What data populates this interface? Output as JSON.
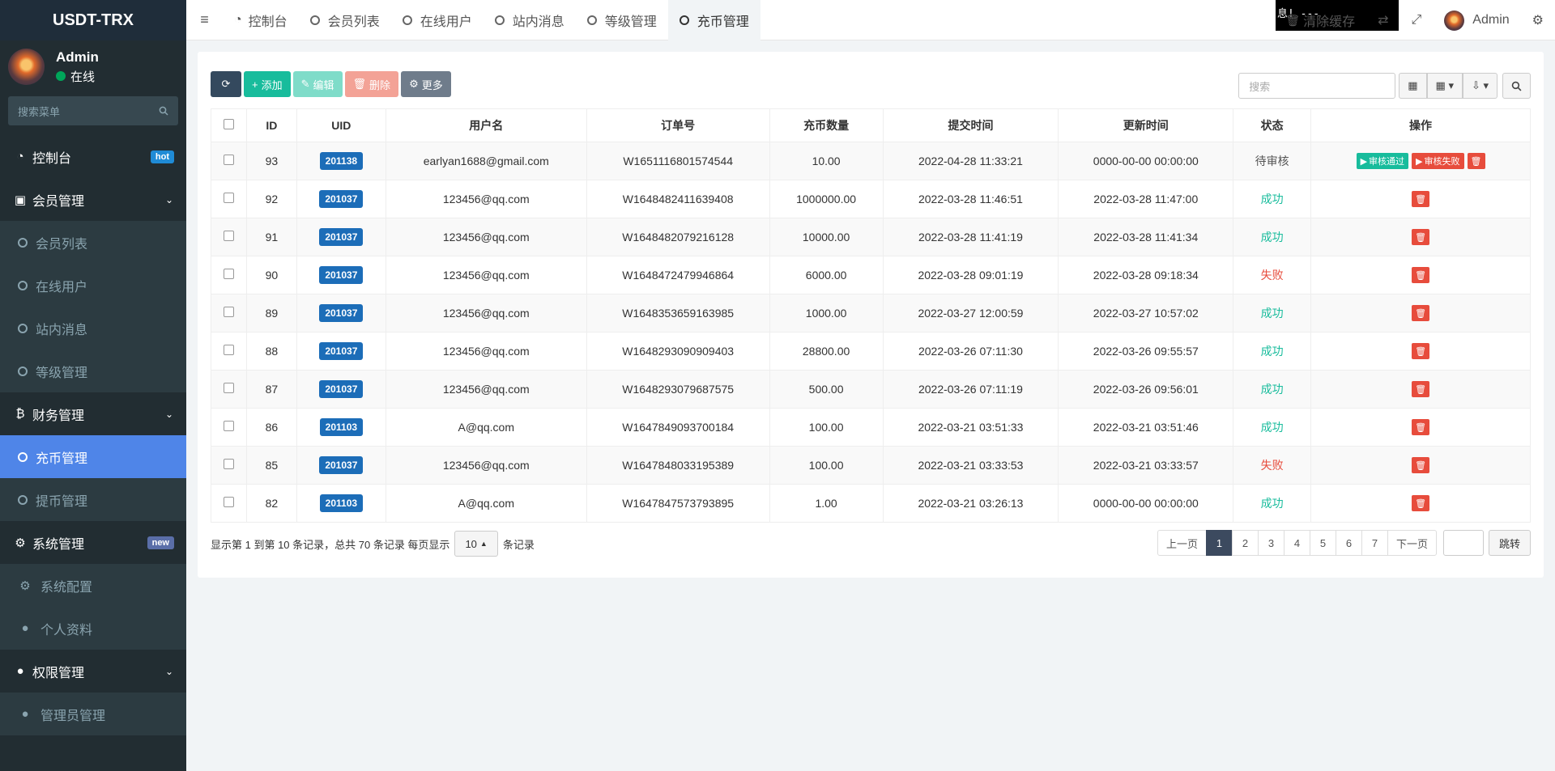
{
  "brand": "USDT-TRX",
  "user": {
    "name": "Admin",
    "status": "在线"
  },
  "sidebar": {
    "search_placeholder": "搜索菜单",
    "items": [
      {
        "label": "控制台",
        "badge": "hot"
      },
      {
        "label": "会员管理"
      },
      {
        "label": "会员列表"
      },
      {
        "label": "在线用户"
      },
      {
        "label": "站内消息"
      },
      {
        "label": "等级管理"
      },
      {
        "label": "财务管理"
      },
      {
        "label": "充币管理"
      },
      {
        "label": "提币管理"
      },
      {
        "label": "系统管理",
        "badge": "new"
      },
      {
        "label": "系统配置"
      },
      {
        "label": "个人资料"
      },
      {
        "label": "权限管理"
      },
      {
        "label": "管理员管理"
      }
    ]
  },
  "topbar": {
    "tabs": [
      "控制台",
      "会员列表",
      "在线用户",
      "站内消息",
      "等级管理",
      "充币管理"
    ],
    "console_text": "息! ---",
    "clear_cache": "清除缓存",
    "admin": "Admin"
  },
  "toolbar": {
    "add": "添加",
    "edit": "编辑",
    "delete": "删除",
    "more": "更多",
    "search_placeholder": "搜索"
  },
  "table": {
    "headers": [
      "ID",
      "UID",
      "用户名",
      "订单号",
      "充币数量",
      "提交时间",
      "更新时间",
      "状态",
      "操作"
    ],
    "rows": [
      {
        "id": "93",
        "uid": "201138",
        "username": "earlyan1688@gmail.com",
        "order": "W1651116801574544",
        "amount": "10.00",
        "submit": "2022-04-28 11:33:21",
        "update": "0000-00-00 00:00:00",
        "status": "待审核"
      },
      {
        "id": "92",
        "uid": "201037",
        "username": "123456@qq.com",
        "order": "W1648482411639408",
        "amount": "1000000.00",
        "submit": "2022-03-28 11:46:51",
        "update": "2022-03-28 11:47:00",
        "status": "成功"
      },
      {
        "id": "91",
        "uid": "201037",
        "username": "123456@qq.com",
        "order": "W1648482079216128",
        "amount": "10000.00",
        "submit": "2022-03-28 11:41:19",
        "update": "2022-03-28 11:41:34",
        "status": "成功"
      },
      {
        "id": "90",
        "uid": "201037",
        "username": "123456@qq.com",
        "order": "W1648472479946864",
        "amount": "6000.00",
        "submit": "2022-03-28 09:01:19",
        "update": "2022-03-28 09:18:34",
        "status": "失败"
      },
      {
        "id": "89",
        "uid": "201037",
        "username": "123456@qq.com",
        "order": "W1648353659163985",
        "amount": "1000.00",
        "submit": "2022-03-27 12:00:59",
        "update": "2022-03-27 10:57:02",
        "status": "成功"
      },
      {
        "id": "88",
        "uid": "201037",
        "username": "123456@qq.com",
        "order": "W1648293090909403",
        "amount": "28800.00",
        "submit": "2022-03-26 07:11:30",
        "update": "2022-03-26 09:55:57",
        "status": "成功"
      },
      {
        "id": "87",
        "uid": "201037",
        "username": "123456@qq.com",
        "order": "W1648293079687575",
        "amount": "500.00",
        "submit": "2022-03-26 07:11:19",
        "update": "2022-03-26 09:56:01",
        "status": "成功"
      },
      {
        "id": "86",
        "uid": "201103",
        "username": "A@qq.com",
        "order": "W1647849093700184",
        "amount": "100.00",
        "submit": "2022-03-21 03:51:33",
        "update": "2022-03-21 03:51:46",
        "status": "成功"
      },
      {
        "id": "85",
        "uid": "201037",
        "username": "123456@qq.com",
        "order": "W1647848033195389",
        "amount": "100.00",
        "submit": "2022-03-21 03:33:53",
        "update": "2022-03-21 03:33:57",
        "status": "失败"
      },
      {
        "id": "82",
        "uid": "201103",
        "username": "A@qq.com",
        "order": "W1647847573793895",
        "amount": "1.00",
        "submit": "2022-03-21 03:26:13",
        "update": "0000-00-00 00:00:00",
        "status": "成功"
      }
    ],
    "ops": {
      "approve": "审核通过",
      "reject": "审核失败"
    }
  },
  "footer": {
    "info_prefix": "显示第 1 到第 10 条记录，总共 70 条记录 每页显示",
    "page_size": "10",
    "info_suffix": "条记录",
    "prev": "上一页",
    "pages": [
      "1",
      "2",
      "3",
      "4",
      "5",
      "6",
      "7"
    ],
    "next": "下一页",
    "jump": "跳转"
  }
}
